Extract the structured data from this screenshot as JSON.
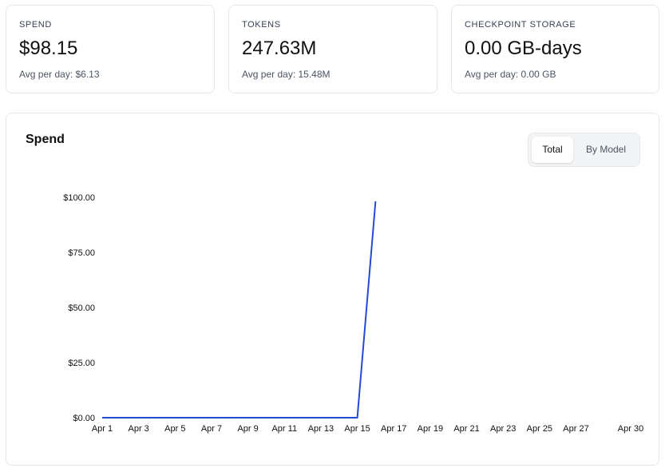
{
  "stats": [
    {
      "label": "SPEND",
      "value": "$98.15",
      "sub": "Avg per day: $6.13"
    },
    {
      "label": "TOKENS",
      "value": "247.63M",
      "sub": "Avg per day: 15.48M"
    },
    {
      "label": "CHECKPOINT STORAGE",
      "value": "0.00 GB-days",
      "sub": "Avg per day: 0.00 GB"
    }
  ],
  "chart_panel": {
    "title": "Spend",
    "toggle": {
      "total_label": "Total",
      "by_model_label": "By Model",
      "selected": "Total"
    }
  },
  "chart_data": {
    "type": "line",
    "title": "Spend",
    "xlabel": "",
    "ylabel": "",
    "x_tick_labels": [
      "Apr 1",
      "Apr 3",
      "Apr 5",
      "Apr 7",
      "Apr 9",
      "Apr 11",
      "Apr 13",
      "Apr 15",
      "Apr 17",
      "Apr 19",
      "Apr 21",
      "Apr 23",
      "Apr 25",
      "Apr 27",
      "Apr 30"
    ],
    "x_ticks_day": [
      1,
      3,
      5,
      7,
      9,
      11,
      13,
      15,
      17,
      19,
      21,
      23,
      25,
      27,
      30
    ],
    "y_tick_labels": [
      "$0.00",
      "$25.00",
      "$50.00",
      "$75.00",
      "$100.00"
    ],
    "y_ticks": [
      0,
      25,
      50,
      75,
      100
    ],
    "ylim": [
      0,
      100
    ],
    "xlim_day": [
      1,
      30
    ],
    "grid": false,
    "series_color": "#2449d6",
    "series": [
      {
        "x": [
          "Apr 1",
          "Apr 2",
          "Apr 3",
          "Apr 4",
          "Apr 5",
          "Apr 6",
          "Apr 7",
          "Apr 8",
          "Apr 9",
          "Apr 10",
          "Apr 11",
          "Apr 12",
          "Apr 13",
          "Apr 14",
          "Apr 15",
          "Apr 16"
        ],
        "day": [
          1,
          2,
          3,
          4,
          5,
          6,
          7,
          8,
          9,
          10,
          11,
          12,
          13,
          14,
          15,
          16
        ],
        "values": [
          0,
          0,
          0,
          0,
          0,
          0,
          0,
          0,
          0,
          0,
          0,
          0,
          0,
          0,
          0,
          98.15
        ]
      }
    ]
  }
}
